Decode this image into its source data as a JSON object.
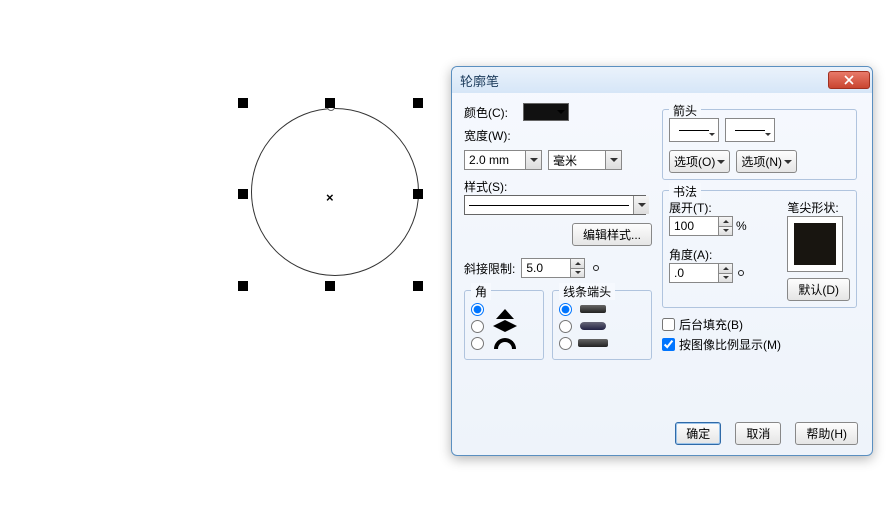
{
  "dialog": {
    "title": "轮廓笔",
    "color_label": "颜色(C):",
    "width_label": "宽度(W):",
    "width_value": "2.0 mm",
    "width_unit": "毫米",
    "style_label": "样式(S):",
    "edit_style_btn": "编辑样式...",
    "miter_label": "斜接限制:",
    "miter_value": "5.0",
    "corners_title": "角",
    "caps_title": "线条端头",
    "arrows_title": "箭头",
    "options_btn1": "选项(O)",
    "options_btn2": "选项(N)",
    "callig_title": "书法",
    "stretch_label": "展开(T):",
    "stretch_value": "100",
    "percent": "%",
    "angle_label": "角度(A):",
    "angle_value": ".0",
    "nib_label": "笔尖形状:",
    "default_btn": "默认(D)",
    "behind_fill": "后台填充(B)",
    "scale_with_image": "按图像比例显示(M)",
    "ok": "确定",
    "cancel": "取消",
    "help": "帮助(H)"
  }
}
